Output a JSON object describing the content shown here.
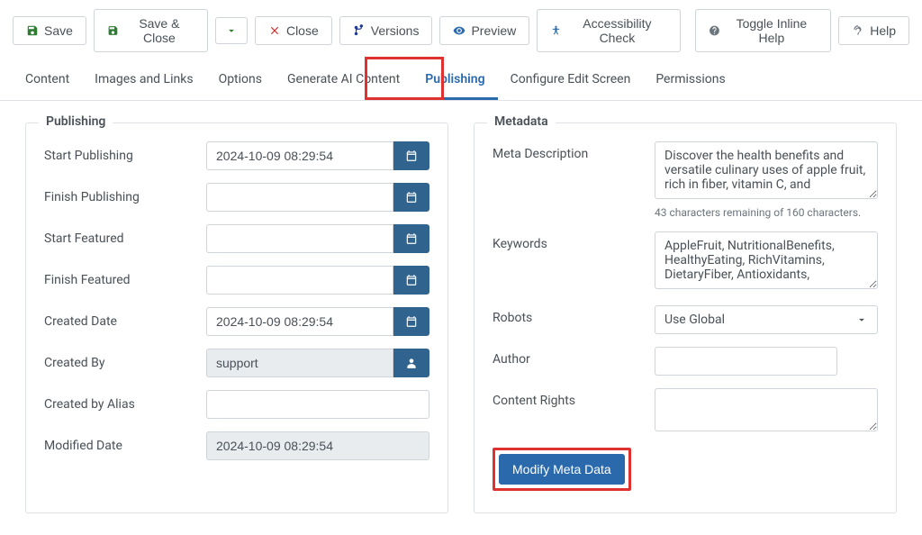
{
  "toolbar": {
    "save": "Save",
    "saveClose": "Save & Close",
    "close": "Close",
    "versions": "Versions",
    "preview": "Preview",
    "accessibility": "Accessibility Check",
    "toggleHelp": "Toggle Inline Help",
    "help": "Help"
  },
  "tabs": {
    "content": "Content",
    "images": "Images and Links",
    "options": "Options",
    "aiContent": "Generate AI Content",
    "publishing": "Publishing",
    "configure": "Configure Edit Screen",
    "permissions": "Permissions"
  },
  "publishing": {
    "legend": "Publishing",
    "startPublishingLabel": "Start Publishing",
    "startPublishingValue": "2024-10-09 08:29:54",
    "finishPublishingLabel": "Finish Publishing",
    "finishPublishingValue": "",
    "startFeaturedLabel": "Start Featured",
    "startFeaturedValue": "",
    "finishFeaturedLabel": "Finish Featured",
    "finishFeaturedValue": "",
    "createdDateLabel": "Created Date",
    "createdDateValue": "2024-10-09 08:29:54",
    "createdByLabel": "Created By",
    "createdByValue": "support",
    "createdByAliasLabel": "Created by Alias",
    "createdByAliasValue": "",
    "modifiedDateLabel": "Modified Date",
    "modifiedDateValue": "2024-10-09 08:29:54"
  },
  "metadata": {
    "legend": "Metadata",
    "metaDescriptionLabel": "Meta Description",
    "metaDescriptionValue": "Discover the health benefits and versatile culinary uses of apple fruit, rich in fiber, vitamin C, and",
    "metaDescriptionHelper": "43 characters remaining of 160 characters.",
    "keywordsLabel": "Keywords",
    "keywordsValue": "AppleFruit, NutritionalBenefits, HealthyEating, RichVitamins, DietaryFiber, Antioxidants,",
    "robotsLabel": "Robots",
    "robotsValue": "Use Global",
    "authorLabel": "Author",
    "authorValue": "",
    "contentRightsLabel": "Content Rights",
    "contentRightsValue": "",
    "modifyButton": "Modify Meta Data"
  }
}
